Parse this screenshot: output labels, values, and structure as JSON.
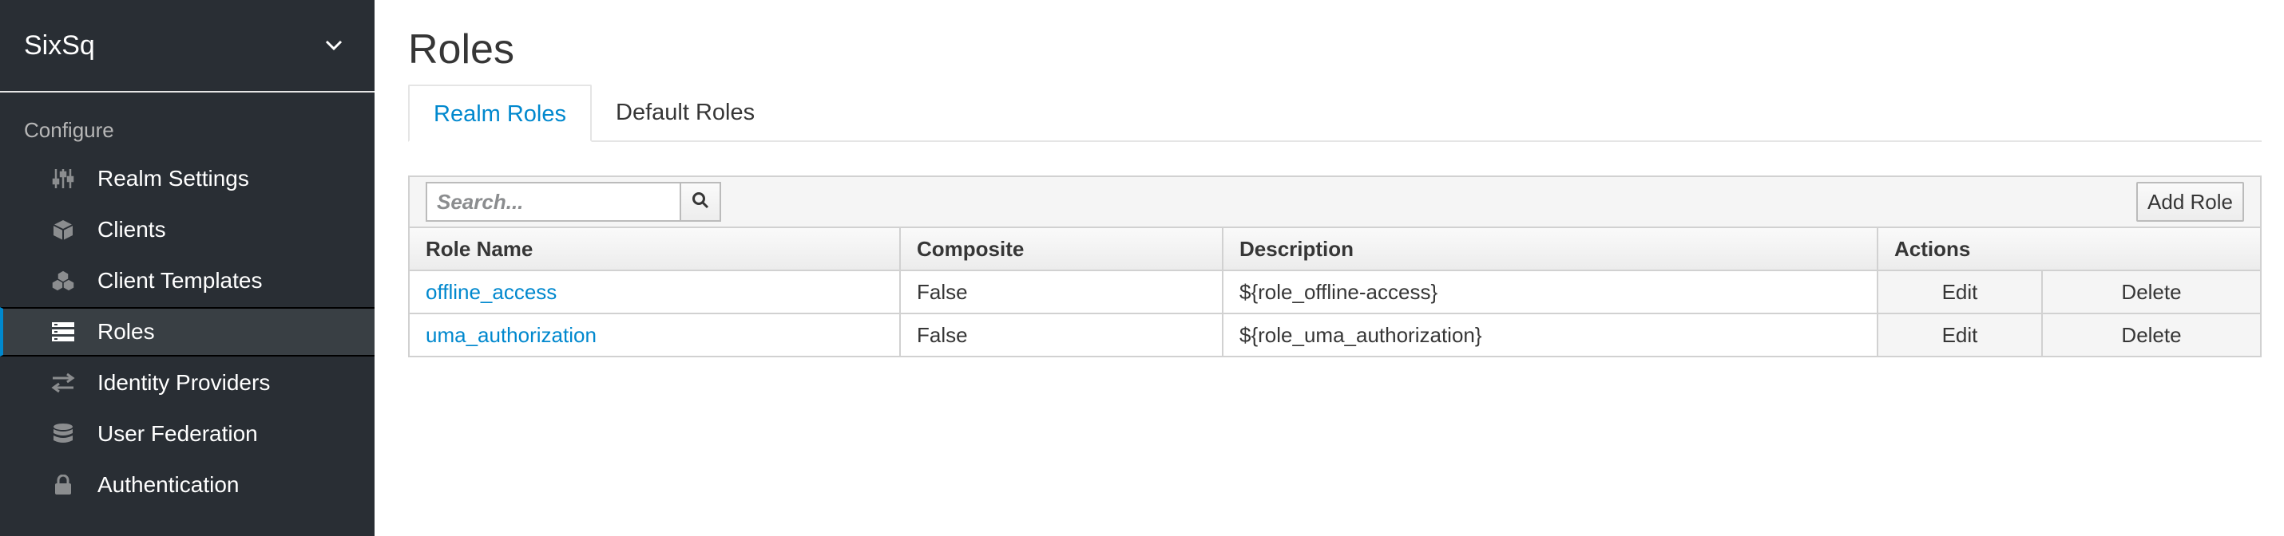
{
  "sidebar": {
    "realm": "SixSq",
    "section_label": "Configure",
    "items": [
      {
        "label": "Realm Settings",
        "icon": "sliders-icon"
      },
      {
        "label": "Clients",
        "icon": "cube-icon"
      },
      {
        "label": "Client Templates",
        "icon": "cubes-icon"
      },
      {
        "label": "Roles",
        "icon": "roles-icon",
        "active": true
      },
      {
        "label": "Identity Providers",
        "icon": "exchange-icon"
      },
      {
        "label": "User Federation",
        "icon": "database-icon"
      },
      {
        "label": "Authentication",
        "icon": "lock-icon"
      }
    ]
  },
  "main": {
    "title": "Roles",
    "tabs": [
      {
        "label": "Realm Roles",
        "active": true
      },
      {
        "label": "Default Roles"
      }
    ],
    "search": {
      "placeholder": "Search...",
      "value": ""
    },
    "add_button": "Add Role",
    "columns": [
      "Role Name",
      "Composite",
      "Description",
      "Actions"
    ],
    "rows": [
      {
        "name": "offline_access",
        "composite": "False",
        "description": "${role_offline-access}",
        "edit": "Edit",
        "delete": "Delete"
      },
      {
        "name": "uma_authorization",
        "composite": "False",
        "description": "${role_uma_authorization}",
        "edit": "Edit",
        "delete": "Delete"
      }
    ]
  },
  "colors": {
    "sidebar_bg": "#292e34",
    "accent": "#0088ce",
    "text": "#363636"
  }
}
